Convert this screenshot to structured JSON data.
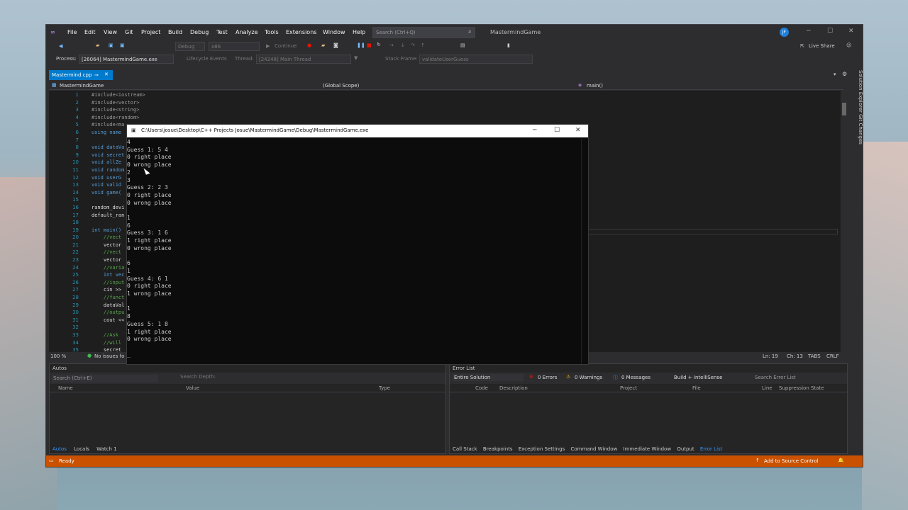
{
  "menu": [
    "File",
    "Edit",
    "View",
    "Git",
    "Project",
    "Build",
    "Debug",
    "Test",
    "Analyze",
    "Tools",
    "Extensions",
    "Window",
    "Help"
  ],
  "search_placeholder": "Search (Ctrl+Q)",
  "project_name": "MastermindGame",
  "user_initials": "JF",
  "live_share": "Live Share",
  "toolbar": {
    "config": "Debug",
    "platform": "x86",
    "continue": "Continue"
  },
  "debug_bar": {
    "process_label": "Process:",
    "process": "[26064] MastermindGame.exe",
    "lifecycle": "Lifecycle Events",
    "thread_label": "Thread:",
    "thread": "[24248] Main Thread",
    "stack_label": "Stack Frame:",
    "stack": "validateUserGuess"
  },
  "tab": {
    "name": "Mastermind.cpp"
  },
  "nav": {
    "project": "MastermindGame",
    "scope": "(Global Scope)",
    "func": "main()"
  },
  "side_tabs": "Solution Explorer   Git Changes",
  "line_numbers": "1\n2\n3\n4\n5\n6\n7\n8\n9\n10\n11\n12\n13\n14\n15\n16\n17\n18\n19\n20\n21\n22\n23\n24\n25\n26\n27\n28\n29\n30\n31\n32\n33\n34\n35",
  "code_lines": [
    "#include<iostream>",
    "#include<vector>",
    "#include<string>",
    "#include<random>",
    "#include<ma",
    "using name",
    "",
    "void dataVa",
    "void secret",
    "void allZe",
    "void random",
    "void userG",
    "void valid",
    "void game(",
    "",
    "random_devi",
    "default_ran",
    "",
    "int main()",
    "    //vect",
    "    vector",
    "    //vect",
    "    vector",
    "    //varia",
    "    int vec",
    "    //input",
    "    cin >>",
    "    //funct",
    "    dataVal",
    "    //outpu",
    "    cout <<",
    "",
    "    //Ask",
    "    //will",
    "    secret"
  ],
  "status": {
    "zoom": "100 %",
    "issues": "No issues fo",
    "ln": "Ln: 19",
    "ch": "Ch: 13",
    "tabs": "TABS",
    "crlf": "CRLF"
  },
  "autos": {
    "title": "Autos",
    "search": "Search (Ctrl+E)",
    "depth_label": "Search Depth:",
    "col_name": "Name",
    "col_value": "Value",
    "col_type": "Type",
    "tabs": [
      "Autos",
      "Locals",
      "Watch 1"
    ]
  },
  "errors": {
    "title": "Error List",
    "scope": "Entire Solution",
    "errors": "0 Errors",
    "warnings": "0 Warnings",
    "messages": "0 Messages",
    "build": "Build + IntelliSense",
    "search": "Search Error List",
    "cols": [
      "Code",
      "Description",
      "Project",
      "File",
      "Line",
      "Suppression State"
    ],
    "tabs": [
      "Call Stack",
      "Breakpoints",
      "Exception Settings",
      "Command Window",
      "Immediate Window",
      "Output",
      "Error List"
    ]
  },
  "ready": {
    "text": "Ready",
    "source": "Add to Source Control"
  },
  "console": {
    "title": "C:\\Users\\josue\\Desktop\\C++ Projects Josue\\MastermindGame\\Debug\\MastermindGame.exe",
    "output": "4\nGuess 1: 5 4\n0 right place\n0 wrong place\n2\n3\nGuess 2: 2 3\n0 right place\n0 wrong place\n\n1\n6\nGuess 3: 1 6\n1 right place\n0 wrong place\n\n6\n1\nGuess 4: 6 1\n0 right place\n1 wrong place\n\n1\n8\nGuess 5: 1 8\n1 right place\n0 wrong place\n\n_"
  },
  "colors": {
    "accent": "#007acc",
    "status": "#ca5100"
  }
}
